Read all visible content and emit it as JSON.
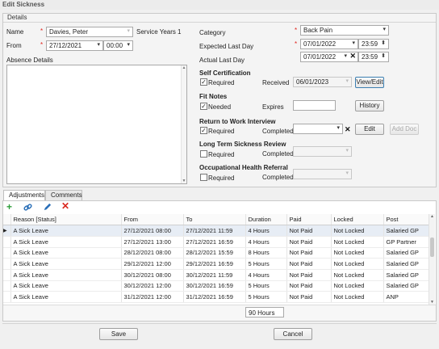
{
  "window": {
    "title": "Edit Sickness"
  },
  "details_group": "Details",
  "left": {
    "name_label": "Name",
    "name_value": "Davies, Peter",
    "service_years_label": "Service Years",
    "service_years_value": "1",
    "from_label": "From",
    "from_date": "27/12/2021",
    "from_time": "00:00",
    "absence_details_label": "Absence Details"
  },
  "right": {
    "category_label": "Category",
    "category_value": "Back Pain",
    "expected_last_day_label": "Expected Last Day",
    "expected_date": "07/01/2022",
    "expected_time": "23:59",
    "actual_last_day_label": "Actual Last Day",
    "actual_date": "07/01/2022",
    "actual_time": "23:59"
  },
  "self_cert": {
    "title": "Self Certification",
    "required_label": "Required",
    "required_checked": true,
    "received_label": "Received",
    "received_value": "06/01/2023",
    "view_edit_label": "View/Edit"
  },
  "fit_notes": {
    "title": "Fit Notes",
    "needed_label": "Needed",
    "needed_checked": true,
    "expires_label": "Expires",
    "expires_value": "",
    "history_label": "History"
  },
  "rtw": {
    "title": "Return to Work Interview",
    "required_label": "Required",
    "required_checked": true,
    "completed_label": "Completed",
    "completed_value": "",
    "edit_label": "Edit",
    "add_doc_label": "Add Doc"
  },
  "ltsr": {
    "title": "Long Term Sickness Review",
    "required_label": "Required",
    "required_checked": false,
    "completed_label": "Completed"
  },
  "ohr": {
    "title": "Occupational Health Referral",
    "required_label": "Required",
    "required_checked": false,
    "completed_label": "Completed"
  },
  "tabs": [
    {
      "label": "Adjustments",
      "active": true
    },
    {
      "label": "Comments",
      "active": false
    }
  ],
  "toolbar_icons": [
    "add-icon",
    "link-icon",
    "edit-icon",
    "delete-icon"
  ],
  "grid": {
    "columns": [
      "Reason [Status]",
      "From",
      "To",
      "Duration",
      "Paid",
      "Locked",
      "Post"
    ],
    "rows": [
      [
        "A Sick Leave",
        "27/12/2021 08:00",
        "27/12/2021 11:59",
        "4 Hours",
        "Not Paid",
        "Not Locked",
        "Salaried GP"
      ],
      [
        "A Sick Leave",
        "27/12/2021 13:00",
        "27/12/2021 16:59",
        "4 Hours",
        "Not Paid",
        "Not Locked",
        "GP Partner"
      ],
      [
        "A Sick Leave",
        "28/12/2021 08:00",
        "28/12/2021 15:59",
        "8 Hours",
        "Not Paid",
        "Not Locked",
        "Salaried GP"
      ],
      [
        "A Sick Leave",
        "29/12/2021 12:00",
        "29/12/2021 16:59",
        "5 Hours",
        "Not Paid",
        "Not Locked",
        "Salaried GP"
      ],
      [
        "A Sick Leave",
        "30/12/2021 08:00",
        "30/12/2021 11:59",
        "4 Hours",
        "Not Paid",
        "Not Locked",
        "Salaried GP"
      ],
      [
        "A Sick Leave",
        "30/12/2021 12:00",
        "30/12/2021 16:59",
        "5 Hours",
        "Not Paid",
        "Not Locked",
        "Salaried GP"
      ],
      [
        "A Sick Leave",
        "31/12/2021 12:00",
        "31/12/2021 16:59",
        "5 Hours",
        "Not Paid",
        "Not Locked",
        "ANP"
      ]
    ],
    "total_duration": "90 Hours"
  },
  "footer": {
    "save_label": "Save",
    "cancel_label": "Cancel"
  },
  "colors": {
    "required_marker": "#e0221c",
    "add": "#2e9e3a",
    "delete": "#d9281f",
    "link": "#2a6fb8"
  }
}
